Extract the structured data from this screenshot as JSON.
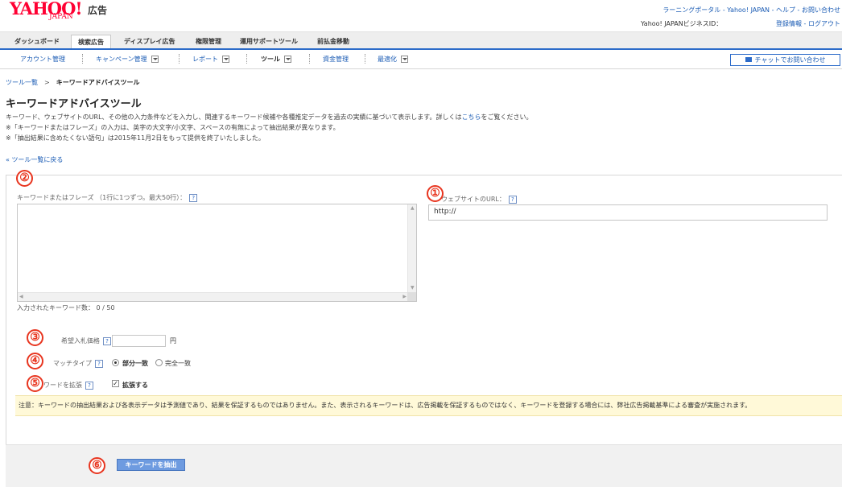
{
  "header": {
    "logo_text": "YAHOO!",
    "logo_sub": "JAPAN",
    "logo_product": "広告",
    "links": "ラーニングポータル - Yahoo! JAPAN - ヘルプ - お問い合わせ",
    "user_label": "Yahoo! JAPANビジネスID：",
    "account_links": "登録情報 - ログアウト"
  },
  "main_tabs": [
    "ダッシュボード",
    "検索広告",
    "ディスプレイ広告",
    "権限管理",
    "運用サポートツール",
    "前払金移動"
  ],
  "sub_nav": [
    "アカウント管理",
    "キャンペーン管理",
    "レポート",
    "ツール",
    "資金管理",
    "最適化"
  ],
  "chat_button": "チャットでお問い合わせ",
  "breadcrumb": {
    "root": "ツール一覧",
    "separator": ">",
    "current": "キーワードアドバイスツール"
  },
  "page_title": "キーワードアドバイスツール",
  "description": {
    "line1_prefix": "キーワード、ウェブサイトのURL、その他の入力条件などを入力し、関連するキーワード候補や各種推定データを過去の実績に基づいて表示します。詳しくは",
    "line1_link": "こちら",
    "line1_suffix": "をご覧ください。",
    "line2": "※「キーワードまたはフレーズ」の入力は、英字の大文字/小文字、スペースの有無によって抽出結果が異なります。",
    "line3": "※「抽出結果に含めたくない語句」は2015年11月2日をもって提供を終了いたしました。"
  },
  "back_link": "« ツール一覧に戻る",
  "form": {
    "keyword_label": "キーワードまたはフレーズ （1行に1つずつ。最大50行）：",
    "keyword_count": "入力されたキーワード数： 0 / 50",
    "url_label": "ウェブサイトのURL：",
    "url_value": "http://",
    "bid_label": "希望入札価格",
    "bid_unit": "円",
    "match_label": "マッチタイプ",
    "match_options": [
      "部分一致",
      "完全一致"
    ],
    "expand_label": "キーワードを拡張",
    "expand_option": "拡張する",
    "help_glyph": "?",
    "notice": "注意：キーワードの抽出結果および各表示データは予測値であり、結果を保証するものではありません。また、表示されるキーワードは、広告掲載を保証するものではなく、キーワードを登録する場合には、弊社広告掲載基準による審査が実施されます。",
    "submit_label": "キーワードを抽出"
  },
  "annotations": [
    "①",
    "②",
    "③",
    "④",
    "⑤",
    "⑥"
  ]
}
